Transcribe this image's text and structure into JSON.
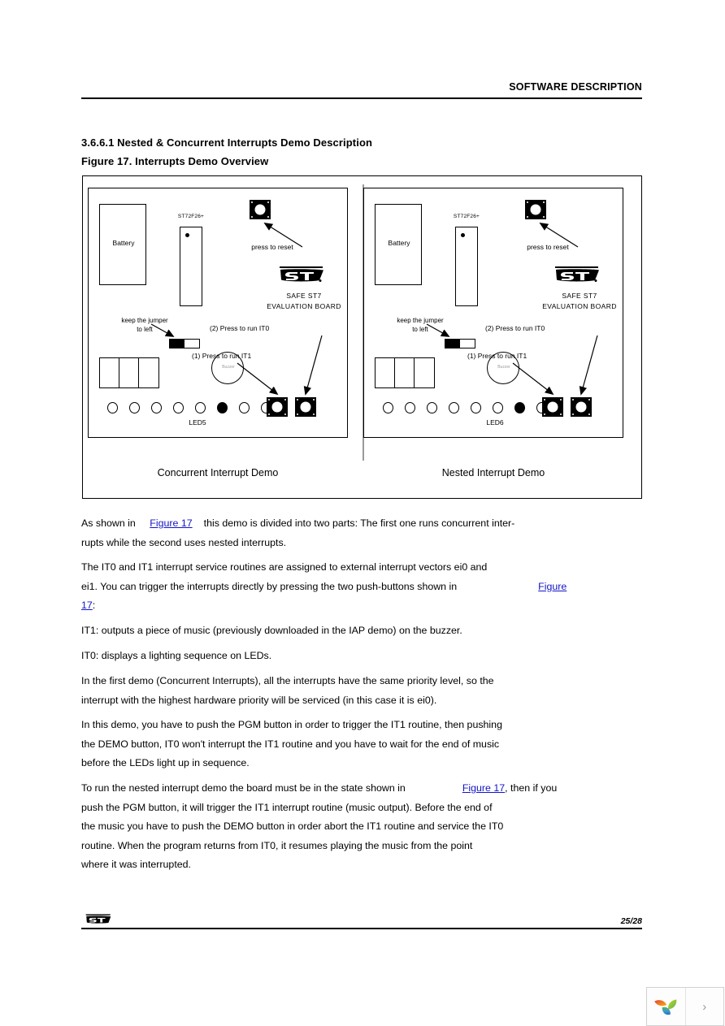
{
  "header": {
    "title": "SOFTWARE DESCRIPTION"
  },
  "headings": {
    "section": "3.6.6.1 Nested & Concurrent Interrupts Demo Description",
    "figure": "Figure 17. Interrupts Demo Overview"
  },
  "figure": {
    "panels": [
      {
        "caption": "Concurrent Interrupt Demo",
        "battery_label": "Battery",
        "mcu_label": "ST72F26+",
        "reset_label": "press to reset",
        "brand_line1": "SAFE ST7",
        "brand_line2": "EVALUATION BOARD",
        "jumper_label_line1": "keep the jumper",
        "jumper_label_line2": "to left",
        "buzzer_label": "Buzzer",
        "it0_label": "(2) Press to run IT0",
        "it1_label": "(1) Press to run IT1",
        "led_label": "LED5",
        "led_count": 8,
        "led_on_index": 5
      },
      {
        "caption": "Nested Interrupt Demo",
        "battery_label": "Battery",
        "mcu_label": "ST72F26+",
        "reset_label": "press to reset",
        "brand_line1": "SAFE ST7",
        "brand_line2": "EVALUATION BOARD",
        "jumper_label_line1": "keep the jumper",
        "jumper_label_line2": "to left",
        "buzzer_label": "Buzzer",
        "it0_label": "(2) Press to run IT0",
        "it1_label": "(1) Press to run IT1",
        "led_label": "LED6",
        "led_count": 8,
        "led_on_index": 6
      }
    ]
  },
  "body": {
    "p1_a": "As shown in",
    "p1_link": "Figure 17",
    "p1_b": "this demo is divided into two parts: The first one runs concurrent inter-",
    "p1_c": "rupts while the second uses nested interrupts.",
    "p2_a": "The IT0 and IT1 interrupt service routines are assigned to external interrupt vectors ei0 and",
    "p2_b": "ei1. You can trigger the interrupts directly by pressing the two push-buttons shown in",
    "p2_link": "Figure",
    "p2_link2": "17",
    "p2_c": ":",
    "p3": "IT1: outputs a piece of music (previously downloaded in the IAP demo) on the buzzer.",
    "p4": "IT0: displays a lighting sequence on LEDs.",
    "p5_a": "In the first demo (Concurrent Interrupts), all the interrupts have the same priority level, so the",
    "p5_b": "interrupt with the highest hardware priority will be serviced (in this case it is ei0).",
    "p6_a": "In this demo, you have to push the PGM button in order to trigger the IT1 routine, then pushing",
    "p6_b": "the DEMO button, IT0 won't interrupt the IT1 routine and you have to wait for the end of music",
    "p6_c": "before the LEDs light up in sequence.",
    "p7_a": "To run the nested interrupt demo the board must be in the state shown in",
    "p7_link": "Figure 17",
    "p7_b": ", then if you",
    "p7_c": "push the PGM button, it will trigger the IT1 interrupt routine (music output). Before the end of",
    "p7_d": "the music you have to push the DEMO button in order abort the IT1 routine and service the IT0",
    "p7_e": "routine. When the program returns from IT0, it resumes playing the music from the point",
    "p7_f": "where it was interrupted."
  },
  "footer": {
    "page_number": "25/28"
  },
  "widget": {
    "next_glyph": "›"
  },
  "colors": {
    "link": "#1414c8",
    "rule": "#000000",
    "petal_orange": "#e8552a",
    "petal_yellow": "#f0a81e",
    "petal_green": "#8cc63f",
    "petal_blue": "#3b8fd0"
  }
}
